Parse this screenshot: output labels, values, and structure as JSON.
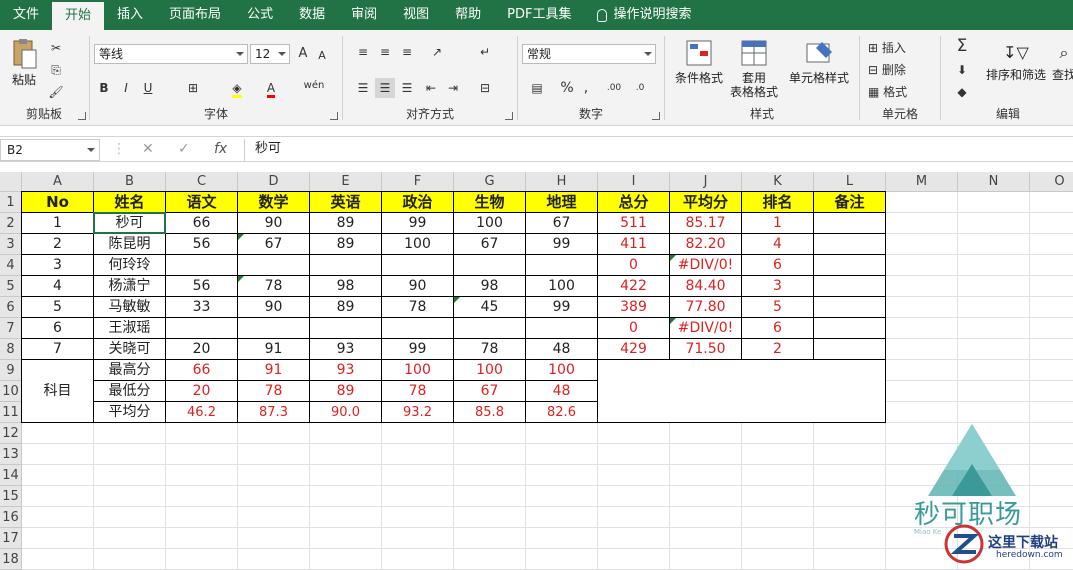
{
  "menu": {
    "items": [
      "文件",
      "开始",
      "插入",
      "页面布局",
      "公式",
      "数据",
      "审阅",
      "视图",
      "帮助",
      "PDF工具集"
    ],
    "active_index": 1,
    "tell_me": "操作说明搜索"
  },
  "ribbon": {
    "clipboard": {
      "paste": "粘贴",
      "label": "剪贴板"
    },
    "font": {
      "name": "等线",
      "size": "12",
      "bold": "B",
      "italic": "I",
      "underline": "U",
      "grow": "A",
      "shrink": "A",
      "phonetic": "wén",
      "label": "字体"
    },
    "alignment": {
      "label": "对齐方式"
    },
    "number": {
      "format": "常规",
      "percent": "%",
      "comma": ",",
      "inc_decimal": ".00",
      "dec_decimal": ".0",
      "label": "数字"
    },
    "styles": {
      "conditional": "条件格式",
      "table_a": "套用",
      "table_b": "表格格式",
      "cell_styles": "单元格样式",
      "label": "样式"
    },
    "cells": {
      "insert": "插入",
      "delete": "删除",
      "format": "格式",
      "label": "单元格"
    },
    "editing": {
      "sort": "排序和筛选",
      "find": "查找",
      "label": "编辑"
    }
  },
  "formula_bar": {
    "name_box": "B2",
    "cancel": "✕",
    "enter": "✓",
    "fx": "fx",
    "formula": "秒可"
  },
  "sheet": {
    "columns": [
      "A",
      "B",
      "C",
      "D",
      "E",
      "F",
      "G",
      "H",
      "I",
      "J",
      "K",
      "L",
      "M",
      "N",
      "O"
    ],
    "rows": [
      "1",
      "2",
      "3",
      "4",
      "5",
      "6",
      "7",
      "8",
      "9",
      "10",
      "11",
      "12",
      "13",
      "14",
      "15",
      "16",
      "17",
      "18"
    ],
    "header": [
      "No",
      "姓名",
      "语文",
      "数学",
      "英语",
      "政治",
      "生物",
      "地理",
      "总分",
      "平均分",
      "排名",
      "备注"
    ],
    "students": [
      {
        "no": "1",
        "name": "秒可",
        "scores": [
          "66",
          "90",
          "89",
          "99",
          "100",
          "67"
        ],
        "total": "511",
        "avg": "85.17",
        "rank": "1"
      },
      {
        "no": "2",
        "name": "陈昆明",
        "scores": [
          "56",
          "67",
          "89",
          "100",
          "67",
          "99"
        ],
        "total": "411",
        "avg": "82.20",
        "rank": "4"
      },
      {
        "no": "3",
        "name": "何玲玲",
        "scores": [
          "",
          "",
          "",
          "",
          "",
          ""
        ],
        "total": "0",
        "avg": "#DIV/0!",
        "rank": "6"
      },
      {
        "no": "4",
        "name": "杨潇宁",
        "scores": [
          "56",
          "78",
          "98",
          "90",
          "98",
          "100"
        ],
        "total": "422",
        "avg": "84.40",
        "rank": "3"
      },
      {
        "no": "5",
        "name": "马敏敏",
        "scores": [
          "33",
          "90",
          "89",
          "78",
          "45",
          "99"
        ],
        "total": "389",
        "avg": "77.80",
        "rank": "5"
      },
      {
        "no": "6",
        "name": "王淑瑶",
        "scores": [
          "",
          "",
          "",
          "",
          "",
          ""
        ],
        "total": "0",
        "avg": "#DIV/0!",
        "rank": "6"
      },
      {
        "no": "7",
        "name": "关晓可",
        "scores": [
          "20",
          "91",
          "93",
          "99",
          "78",
          "48"
        ],
        "total": "429",
        "avg": "71.50",
        "rank": "2"
      }
    ],
    "subject_label": "科目",
    "stats": [
      {
        "label": "最高分",
        "values": [
          "66",
          "91",
          "93",
          "100",
          "100",
          "100"
        ]
      },
      {
        "label": "最低分",
        "values": [
          "20",
          "78",
          "89",
          "78",
          "67",
          "48"
        ]
      },
      {
        "label": "平均分",
        "values": [
          "46.2",
          "87.3",
          "90.0",
          "93.2",
          "85.8",
          "82.6"
        ]
      }
    ]
  },
  "watermark": {
    "brand": "秒可职场",
    "brand_sub": "Miao Ke",
    "site": "这里下载站",
    "site_url": "heredown.com"
  },
  "colors": {
    "ribbon_green": "#217346",
    "header_fill": "#ffff00",
    "red_text": "#e02020",
    "error_triangle": "#1e7b34"
  }
}
